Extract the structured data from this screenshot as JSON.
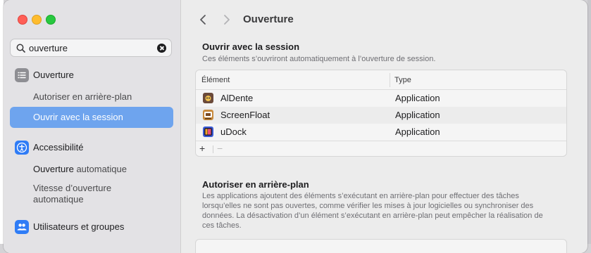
{
  "sidebar": {
    "search": {
      "value": "ouverture"
    },
    "categories": [
      {
        "label": "Ouverture",
        "icon": "list-icon",
        "subitems": [
          "Autoriser en arrière-plan",
          "Ouvrir avec la session"
        ]
      },
      {
        "label": "Accessibilité",
        "icon": "accessibility-icon",
        "subitems": [
          "automatique",
          "Vitesse d’ouverture automatique"
        ]
      },
      {
        "label": "Utilisateurs et groupes",
        "icon": "users-icon",
        "subitems": []
      }
    ],
    "highlight_word": "Ouverture"
  },
  "toolbar": {
    "title": "Ouverture"
  },
  "login_section": {
    "title": "Ouvrir avec la session",
    "description": "Ces éléments s’ouvriront automatiquement à l’ouverture de session.",
    "columns": [
      "Élément",
      "Type"
    ],
    "rows": [
      {
        "name": "AlDente",
        "type": "Application",
        "icon_color": "#6b4a3a"
      },
      {
        "name": "ScreenFloat",
        "type": "Application",
        "icon_color": "#c88a3d"
      },
      {
        "name": "uDock",
        "type": "Application",
        "icon_color": "#3b5bd6"
      }
    ],
    "add_label": "+",
    "remove_label": "−"
  },
  "background_section": {
    "title": "Autoriser en arrière-plan",
    "description": "Les applications ajoutent des éléments s’exécutant en arrière-plan pour effectuer des tâches lorsqu’elles ne sont pas ouvertes, comme vérifier les mises à jour logicielles ou synchroniser des données. La désactivation d’un élément s’exécutant en arrière-plan peut empêcher la réalisation de ces tâches."
  },
  "colors": {
    "selection": "#6ea4ee",
    "sidebar_bg": "#e3e2e5",
    "main_bg": "#ececec"
  }
}
